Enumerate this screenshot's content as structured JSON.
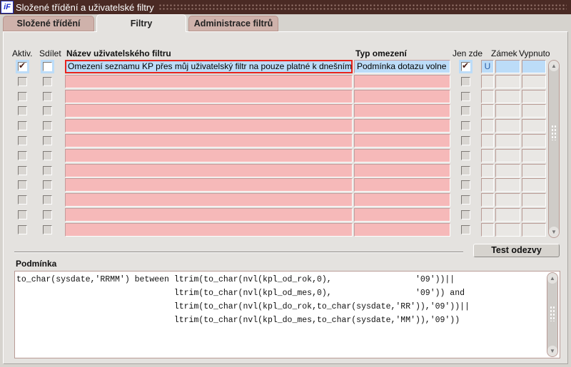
{
  "window": {
    "title": "Složené třídění a uživatelské filtry",
    "logo": "iF"
  },
  "tabs": [
    {
      "label": "Složené třídění",
      "active": false
    },
    {
      "label": "Filtry",
      "active": true
    },
    {
      "label": "Administrace filtrů",
      "active": false
    }
  ],
  "columns": {
    "aktiv": "Aktiv.",
    "sdilet": "Sdílet",
    "nazev": "Název uživatelského filtru",
    "typ": "Typ omezení",
    "jen_zde": "Jen zde",
    "zamek": "Zámek",
    "vypnuto": "Vypnuto"
  },
  "rows": [
    {
      "aktiv": true,
      "sdilet": false,
      "nazev": "Omezení seznamu KP přes můj uživatelský filtr na pouze platné k dnešnímu",
      "typ": "Podmínka dotazu volne",
      "jen_zde": true,
      "u": "U"
    }
  ],
  "empty_row_count": 11,
  "condition": {
    "label": "Podmínka",
    "lines": [
      "to_char(sysdate,'RRMM') between ltrim(to_char(nvl(kpl_od_rok,0),                 '09'))||",
      "                                ltrim(to_char(nvl(kpl_od_mes,0),                 '09')) and",
      "                                ltrim(to_char(nvl(kpl_do_rok,to_char(sysdate,'RR')),'09'))||",
      "                                ltrim(to_char(nvl(kpl_do_mes,to_char(sysdate,'MM')),'09'))"
    ]
  },
  "buttons": {
    "test": "Test odezvy"
  }
}
